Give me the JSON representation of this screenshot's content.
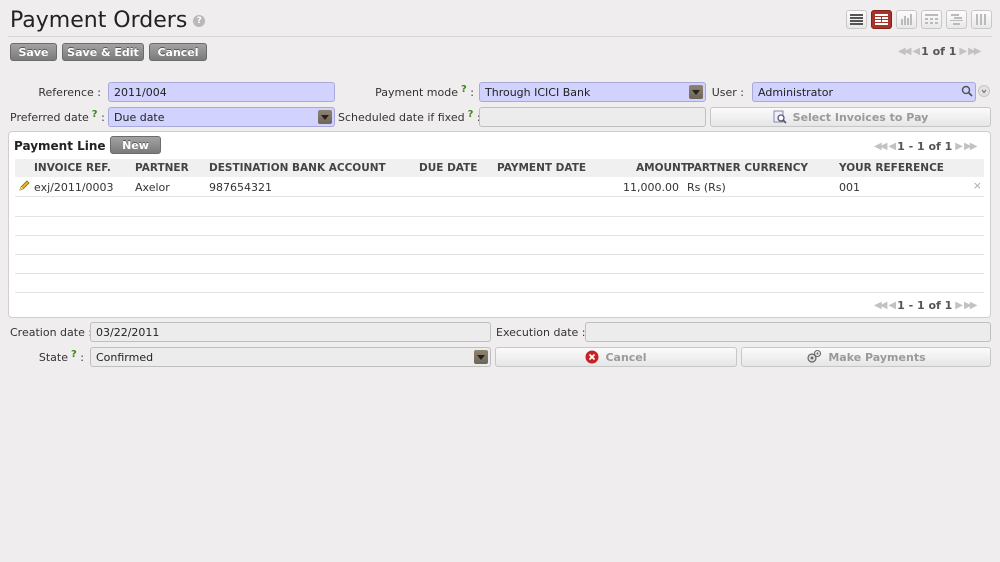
{
  "header": {
    "title": "Payment Orders",
    "help": "?"
  },
  "view_switcher": [
    "list-view",
    "form-view",
    "graph-view",
    "calendar-view",
    "gantt-view",
    "grid-view"
  ],
  "toolbar": {
    "save": "Save",
    "save_edit": "Save & Edit",
    "cancel": "Cancel",
    "pager": "1 of 1"
  },
  "form": {
    "reference_label": "Reference :",
    "reference": "2011/004",
    "payment_mode_label": "Payment mode",
    "payment_mode": "Through ICICI Bank",
    "user_label": "User :",
    "user": "Administrator",
    "preferred_date_label": "Preferred date",
    "preferred_date": "Due date",
    "scheduled_label": "Scheduled date if fixed",
    "scheduled": "",
    "select_invoices": "Select Invoices to Pay",
    "colon": ":",
    "q": "?"
  },
  "lines": {
    "title": "Payment Line",
    "new": "New",
    "pager": "1 - 1 of 1",
    "columns": [
      "INVOICE REF.",
      "PARTNER",
      "DESTINATION BANK ACCOUNT",
      "DUE DATE",
      "PAYMENT DATE",
      "AMOUNT",
      "PARTNER CURRENCY",
      "YOUR REFERENCE"
    ],
    "rows": [
      {
        "invoice": "exj/2011/0003",
        "partner": "Axelor",
        "account": "987654321",
        "due": "",
        "paydate": "",
        "amount": "11,000.00",
        "currency": "Rs (Rs)",
        "yourref": "001"
      }
    ],
    "bottom_pager": "1 - 1 of 1"
  },
  "footer": {
    "creation_label": "Creation date :",
    "creation": "03/22/2011",
    "execution_label": "Execution date :",
    "execution": "",
    "state_label": "State",
    "state": "Confirmed",
    "cancel": "Cancel",
    "make_payments": "Make Payments"
  },
  "colors": {
    "accent": "#a8332a",
    "required_bg": "#d2d2ff",
    "button": "#8c8c8c"
  }
}
